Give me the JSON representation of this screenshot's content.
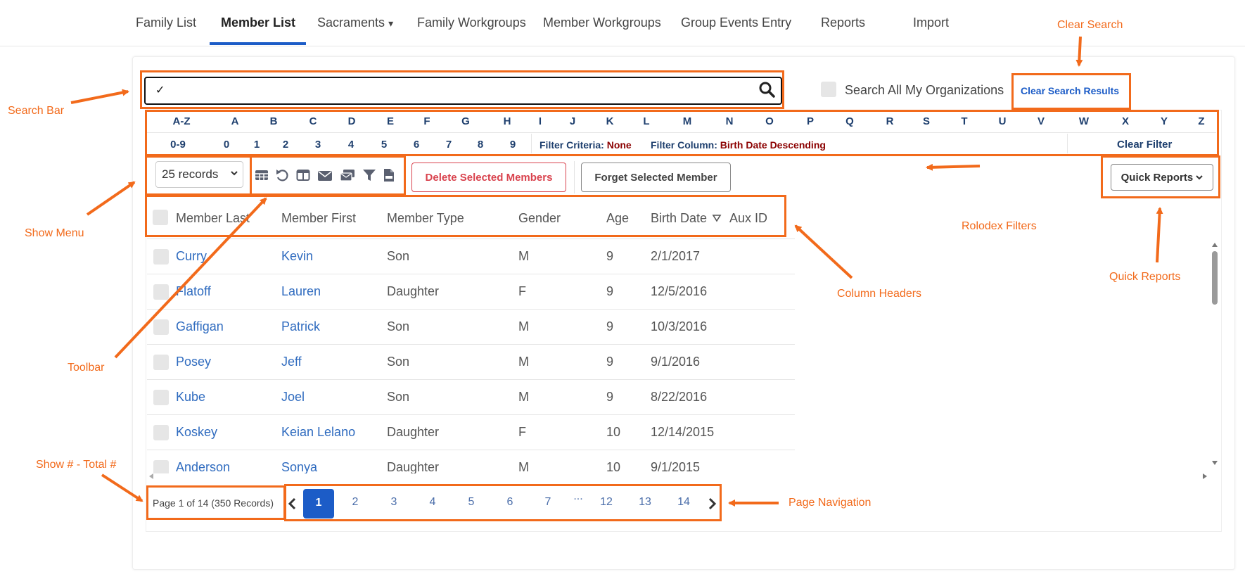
{
  "nav": {
    "tabs": [
      {
        "label": "Family List"
      },
      {
        "label": "Member List"
      },
      {
        "label": "Sacraments"
      },
      {
        "label": "Family Workgroups"
      },
      {
        "label": "Member Workgroups"
      },
      {
        "label": "Group Events Entry"
      },
      {
        "label": "Reports"
      },
      {
        "label": "Import"
      }
    ],
    "active_tab": "Member List",
    "dropdown_caret": "▾"
  },
  "search": {
    "value": "",
    "search_all_label": "Search All My Organizations",
    "clear_label": "Clear Search Results"
  },
  "rolodex": {
    "letters": [
      "A-Z",
      "A",
      "B",
      "C",
      "D",
      "E",
      "F",
      "G",
      "H",
      "I",
      "J",
      "K",
      "L",
      "M",
      "N",
      "O",
      "P",
      "Q",
      "R",
      "S",
      "T",
      "U",
      "V",
      "W",
      "X",
      "Y",
      "Z"
    ],
    "digits": [
      "0-9",
      "0",
      "1",
      "2",
      "3",
      "4",
      "5",
      "6",
      "7",
      "8",
      "9"
    ],
    "filter_criteria_label": "Filter Criteria:",
    "filter_criteria_value": "None",
    "filter_column_label": "Filter Column:",
    "filter_column_value": "Birth Date Descending",
    "clear_filter": "Clear Filter"
  },
  "toolbar": {
    "records": "25 records",
    "icons": [
      "grid-icon",
      "undo-icon",
      "columns-icon",
      "email-icon",
      "mail-merge-icon",
      "filter-icon",
      "csv-file-icon"
    ],
    "delete_label": "Delete Selected Members",
    "forget_label": "Forget Selected Member",
    "quick_reports_label": "Quick Reports"
  },
  "table": {
    "headers": [
      "Member Last",
      "Member First",
      "Member Type",
      "Gender",
      "Age",
      "Birth Date",
      "Aux ID"
    ],
    "rows": [
      {
        "last": "Curry",
        "first": "Kevin",
        "type": "Son",
        "gender": "M",
        "age": "9",
        "birth": "2/1/2017",
        "aux": ""
      },
      {
        "last": "Flatoff",
        "first": "Lauren",
        "type": "Daughter",
        "gender": "F",
        "age": "9",
        "birth": "12/5/2016",
        "aux": ""
      },
      {
        "last": "Gaffigan",
        "first": "Patrick",
        "type": "Son",
        "gender": "M",
        "age": "9",
        "birth": "10/3/2016",
        "aux": ""
      },
      {
        "last": "Posey",
        "first": "Jeff",
        "type": "Son",
        "gender": "M",
        "age": "9",
        "birth": "9/1/2016",
        "aux": ""
      },
      {
        "last": "Kube",
        "first": "Joel",
        "type": "Son",
        "gender": "M",
        "age": "9",
        "birth": "8/22/2016",
        "aux": ""
      },
      {
        "last": "Koskey",
        "first": "Keian Lelano",
        "type": "Daughter",
        "gender": "F",
        "age": "10",
        "birth": "12/14/2015",
        "aux": ""
      },
      {
        "last": "Anderson",
        "first": "Sonya",
        "type": "Daughter",
        "gender": "M",
        "age": "10",
        "birth": "9/1/2015",
        "aux": ""
      }
    ]
  },
  "pagination": {
    "info": "Page 1 of 14 (350 Records)",
    "current": "1",
    "pages": [
      "2",
      "3",
      "4",
      "5",
      "6",
      "7",
      "...",
      "12",
      "13",
      "14"
    ]
  },
  "annotations": {
    "search_bar": "Search Bar",
    "clear_search": "Clear Search",
    "show_menu": "Show Menu",
    "toolbar": "Toolbar",
    "rolodex_filters": "Rolodex Filters",
    "quick_reports": "Quick Reports",
    "column_headers": "Column Headers",
    "show_total": "Show # - Total #",
    "page_navigation": "Page Navigation"
  },
  "colors": {
    "accent": "#1c5cc7",
    "annotation": "#f26a1b",
    "danger": "#d9434e",
    "filter_value": "#8b0000",
    "link": "#2f6bbf"
  }
}
